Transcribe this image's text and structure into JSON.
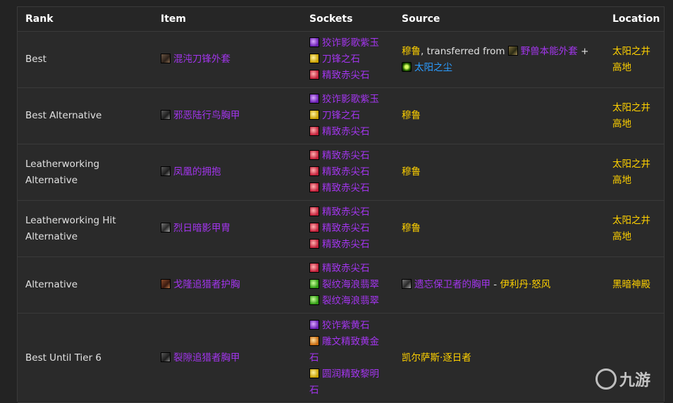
{
  "headers": {
    "rank": "Rank",
    "item": "Item",
    "sockets": "Sockets",
    "source": "Source",
    "location": "Location"
  },
  "rows": [
    {
      "rank": "Best",
      "item": {
        "name": "混沌刀锋外套",
        "icon": "chest-armor-icon"
      },
      "sockets": [
        {
          "name": "狡诈影歌紫玉",
          "color": "purple",
          "icon": "purple-gem-icon"
        },
        {
          "name": "刀锋之石",
          "color": "purple",
          "icon": "yellow-gem-icon"
        },
        {
          "name": "精致赤尖石",
          "color": "purple",
          "icon": "red-gem-icon"
        }
      ],
      "source": {
        "npc": "穆鲁",
        "transfer_text": ", transferred from ",
        "transfer_item": "野兽本能外套",
        "plus": " +",
        "extra_item": "太阳之尘"
      },
      "location": [
        "太阳之井",
        "高地"
      ]
    },
    {
      "rank": "Best Alternative",
      "item": {
        "name": "邪恶陆行鸟胸甲",
        "icon": "chest-armor-icon"
      },
      "sockets": [
        {
          "name": "狡诈影歌紫玉",
          "color": "purple",
          "icon": "purple-gem-icon"
        },
        {
          "name": "刀锋之石",
          "color": "purple",
          "icon": "yellow-gem-icon"
        },
        {
          "name": "精致赤尖石",
          "color": "purple",
          "icon": "red-gem-icon"
        }
      ],
      "source": {
        "npc": "穆鲁"
      },
      "location": [
        "太阳之井",
        "高地"
      ]
    },
    {
      "rank": "Leatherworking Alternative",
      "item": {
        "name": "凤凰的拥抱",
        "icon": "chest-armor-icon"
      },
      "sockets": [
        {
          "name": "精致赤尖石",
          "color": "purple",
          "icon": "red-gem-icon"
        },
        {
          "name": "精致赤尖石",
          "color": "purple",
          "icon": "red-gem-icon"
        },
        {
          "name": "精致赤尖石",
          "color": "purple",
          "icon": "red-gem-icon"
        }
      ],
      "source": {
        "npc": "穆鲁"
      },
      "location": [
        "太阳之井",
        "高地"
      ]
    },
    {
      "rank": "Leatherworking Hit Alternative",
      "item": {
        "name": "烈日暗影甲胄",
        "icon": "chest-armor-icon"
      },
      "sockets": [
        {
          "name": "精致赤尖石",
          "color": "purple",
          "icon": "red-gem-icon"
        },
        {
          "name": "精致赤尖石",
          "color": "purple",
          "icon": "red-gem-icon"
        },
        {
          "name": "精致赤尖石",
          "color": "purple",
          "icon": "red-gem-icon"
        }
      ],
      "source": {
        "npc": "穆鲁"
      },
      "location": [
        "太阳之井",
        "高地"
      ]
    },
    {
      "rank": "Alternative",
      "item": {
        "name": "戈隆追猎者护胸",
        "icon": "chest-armor-icon"
      },
      "sockets": [
        {
          "name": "精致赤尖石",
          "color": "purple",
          "icon": "red-gem-icon"
        },
        {
          "name": "裂纹海浪翡翠",
          "color": "purple",
          "icon": "green-gem-icon"
        },
        {
          "name": "裂纹海浪翡翠",
          "color": "purple",
          "icon": "green-gem-icon"
        }
      ],
      "source": {
        "token": "遗忘保卫者的胸甲",
        "dash": " - ",
        "npc": "伊利丹·怒风"
      },
      "location": [
        "黑暗神殿"
      ]
    },
    {
      "rank": "Best Until Tier 6",
      "item": {
        "name": "裂隙追猎者胸甲",
        "icon": "chest-armor-icon"
      },
      "sockets": [
        {
          "name": "狡诈紫黄石",
          "color": "purple",
          "icon": "purple-gem-icon"
        },
        {
          "name": "雕文精致黄金石",
          "color": "purple",
          "icon": "orange-gem-icon"
        },
        {
          "name": "圆润精致黎明石",
          "color": "purple",
          "icon": "yellow-gem-icon"
        }
      ],
      "source": {
        "npc": "凯尔萨斯·逐日者"
      },
      "location": []
    }
  ],
  "watermark": {
    "text": "九游"
  },
  "colors": {
    "epic": "#a335ee",
    "rare": "#2a9cff",
    "npc": "#ffd100",
    "background": "#2a2a2a"
  }
}
